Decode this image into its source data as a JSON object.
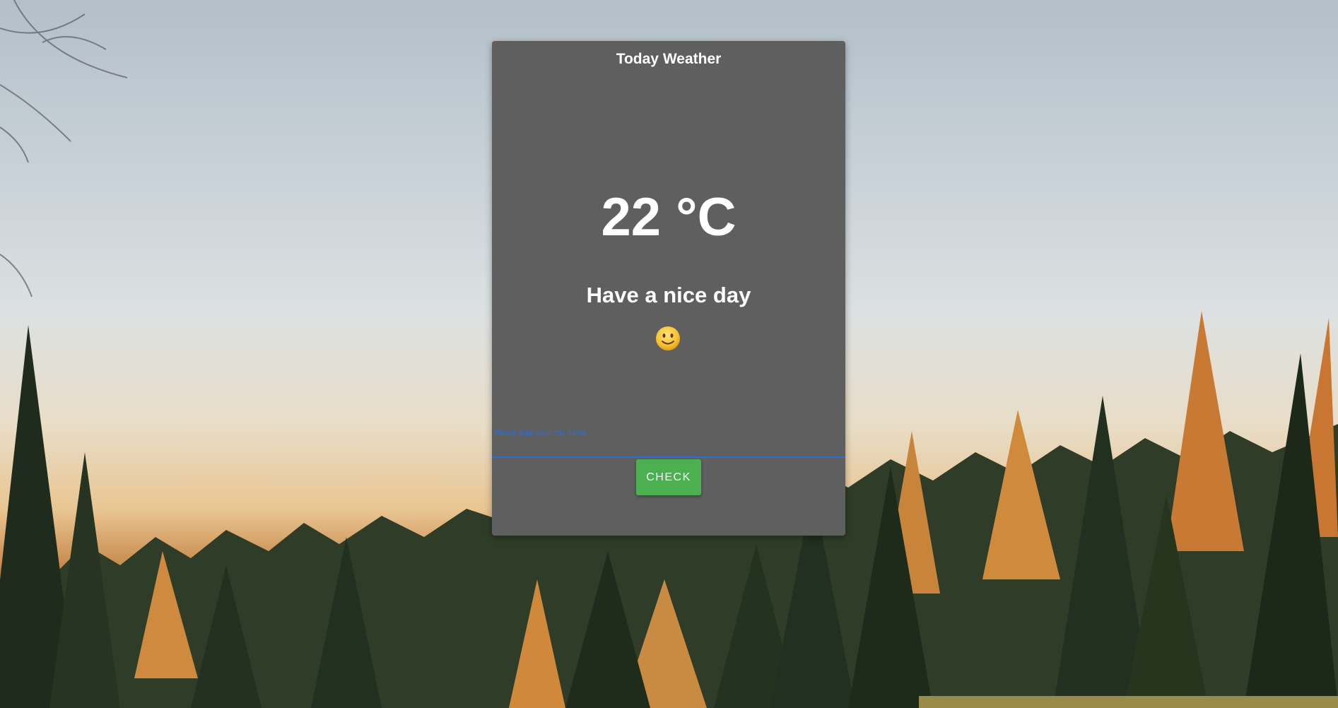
{
  "card": {
    "title": "Today Weather",
    "temperature": "22 °C",
    "message": "Have a nice day",
    "emoji_icon": "slightly-smiling-face-icon"
  },
  "form": {
    "city_label": "Please type your city name",
    "city_value": "",
    "check_label": "CHECK"
  },
  "colors": {
    "card_bg": "#5f5f5f",
    "accent_blue": "#2c6fd3",
    "button_green": "#4caf50"
  }
}
